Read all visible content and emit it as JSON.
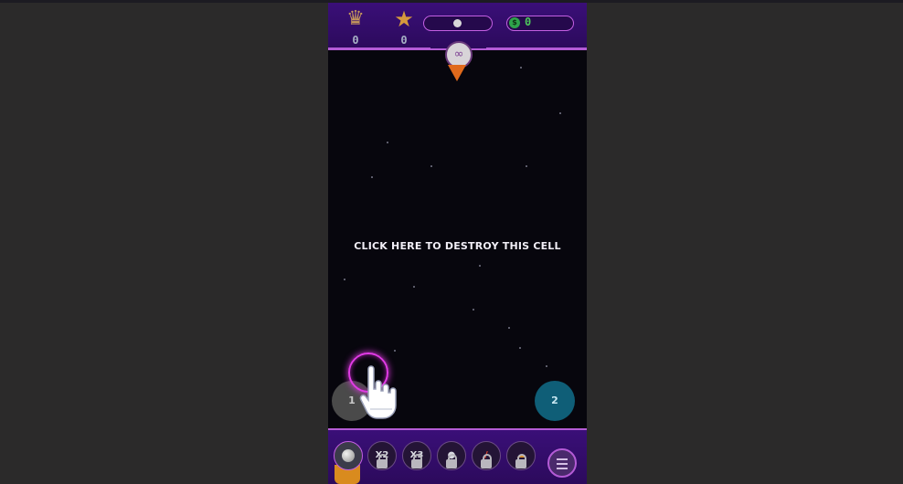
{
  "hud": {
    "crown_icon": "crown-icon",
    "crown_value": "0",
    "star_icon": "star-icon",
    "star_value": "0",
    "coin_value": "0",
    "launcher_symbol": "∞"
  },
  "play_area": {
    "prompt": "CLICK HERE TO DESTROY THIS CELL",
    "cells": [
      {
        "label": "1",
        "color": "#4a4a4a"
      },
      {
        "label": "2",
        "color": "#0f5e77"
      }
    ]
  },
  "toolbar": {
    "tools": [
      {
        "name": "ball",
        "label": "",
        "locked": false
      },
      {
        "name": "x2",
        "label": "X2",
        "locked": true
      },
      {
        "name": "x3",
        "label": "X3",
        "locked": true
      },
      {
        "name": "bomb",
        "label": "",
        "locked": true
      },
      {
        "name": "laser",
        "label": "",
        "locked": true
      },
      {
        "name": "nuke",
        "label": "",
        "locked": true
      }
    ],
    "menu_icon": "menu-icon"
  },
  "colors": {
    "accent": "#b45bd6",
    "highlight": "#e23be6",
    "coin": "#4dc75b",
    "arrow": "#e06a1c"
  }
}
